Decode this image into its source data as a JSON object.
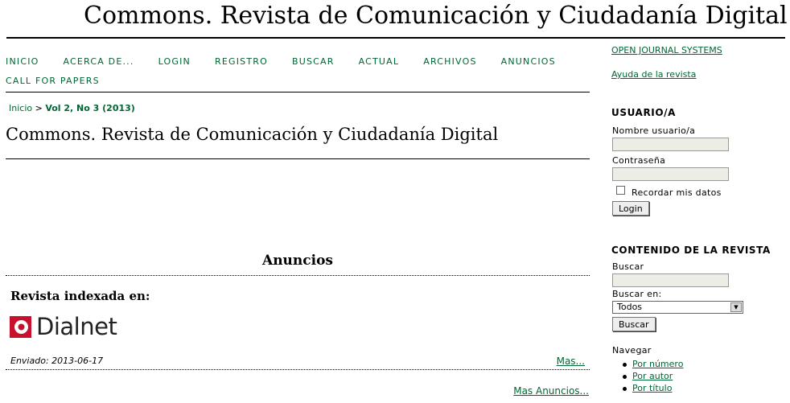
{
  "header": {
    "title": "Commons. Revista de Comunicación y Ciudadanía Digital"
  },
  "nav": {
    "row1": [
      "INICIO",
      "ACERCA DE...",
      "LOGIN",
      "REGISTRO",
      "BUSCAR",
      "ACTUAL",
      "ARCHIVOS",
      "ANUNCIOS"
    ],
    "row2": [
      "CALL FOR PAPERS"
    ]
  },
  "breadcrumb": {
    "home": "Inicio",
    "sep": ">",
    "current": "Vol 2, No 3 (2013)"
  },
  "main": {
    "heading": "Commons. Revista de Comunicación y Ciudadanía Digital",
    "announcements": {
      "title": "Anuncios",
      "item_heading": "Revista indexada en:",
      "logo_text": "Dialnet",
      "posted": "Enviado: 2013-06-17",
      "more": "Mas...",
      "more_all": "Mas Anuncios..."
    }
  },
  "sidebar": {
    "ojs_link": "OPEN JOURNAL SYSTEMS",
    "help_link": "Ayuda de la revista",
    "user": {
      "title": "USUARIO/A",
      "username_label": "Nombre usuario/a",
      "password_label": "Contraseña",
      "remember_label": "Recordar mis datos",
      "login_button": "Login"
    },
    "content": {
      "title": "CONTENIDO DE LA REVISTA",
      "search_label": "Buscar",
      "search_in_label": "Buscar en:",
      "search_in_value": "Todos",
      "search_button": "Buscar",
      "browse_label": "Navegar",
      "browse_items": [
        "Por número",
        "Por autor",
        "Por título"
      ]
    }
  },
  "colors": {
    "link": "#006633"
  }
}
